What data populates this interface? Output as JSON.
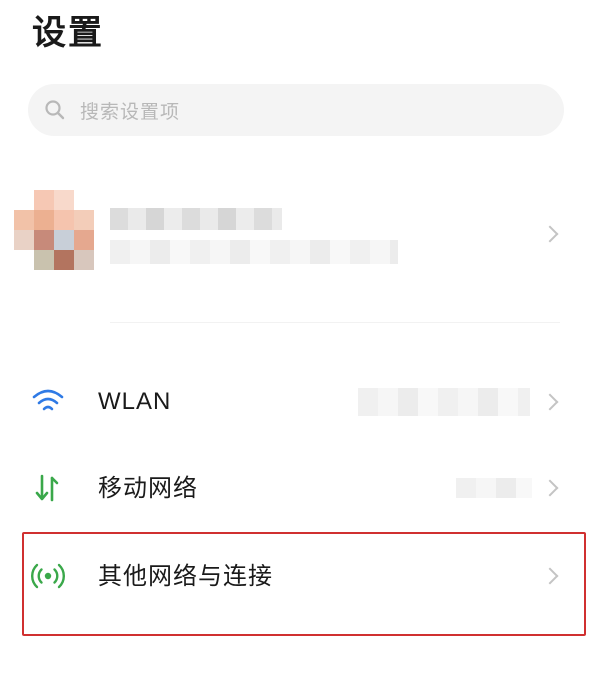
{
  "header": {
    "title": "设置"
  },
  "search": {
    "placeholder": "搜索设置项",
    "icon": "search-icon"
  },
  "account": {
    "avatar_icon": "avatar-pixelated",
    "name_redacted": true
  },
  "menu": {
    "items": [
      {
        "label": "WLAN",
        "icon": "wifi-icon",
        "icon_color": "#2f7ae5",
        "value_redacted": true
      },
      {
        "label": "移动网络",
        "icon": "mobile-data-icon",
        "icon_color": "#3aa84a",
        "value_redacted": true
      },
      {
        "label": "其他网络与连接",
        "icon": "connection-icon",
        "icon_color": "#3aa84a",
        "highlighted": true
      }
    ]
  },
  "colors": {
    "highlight_border": "#d03030",
    "chevron": "#c4c4c4",
    "search_bg": "#f4f4f4"
  }
}
